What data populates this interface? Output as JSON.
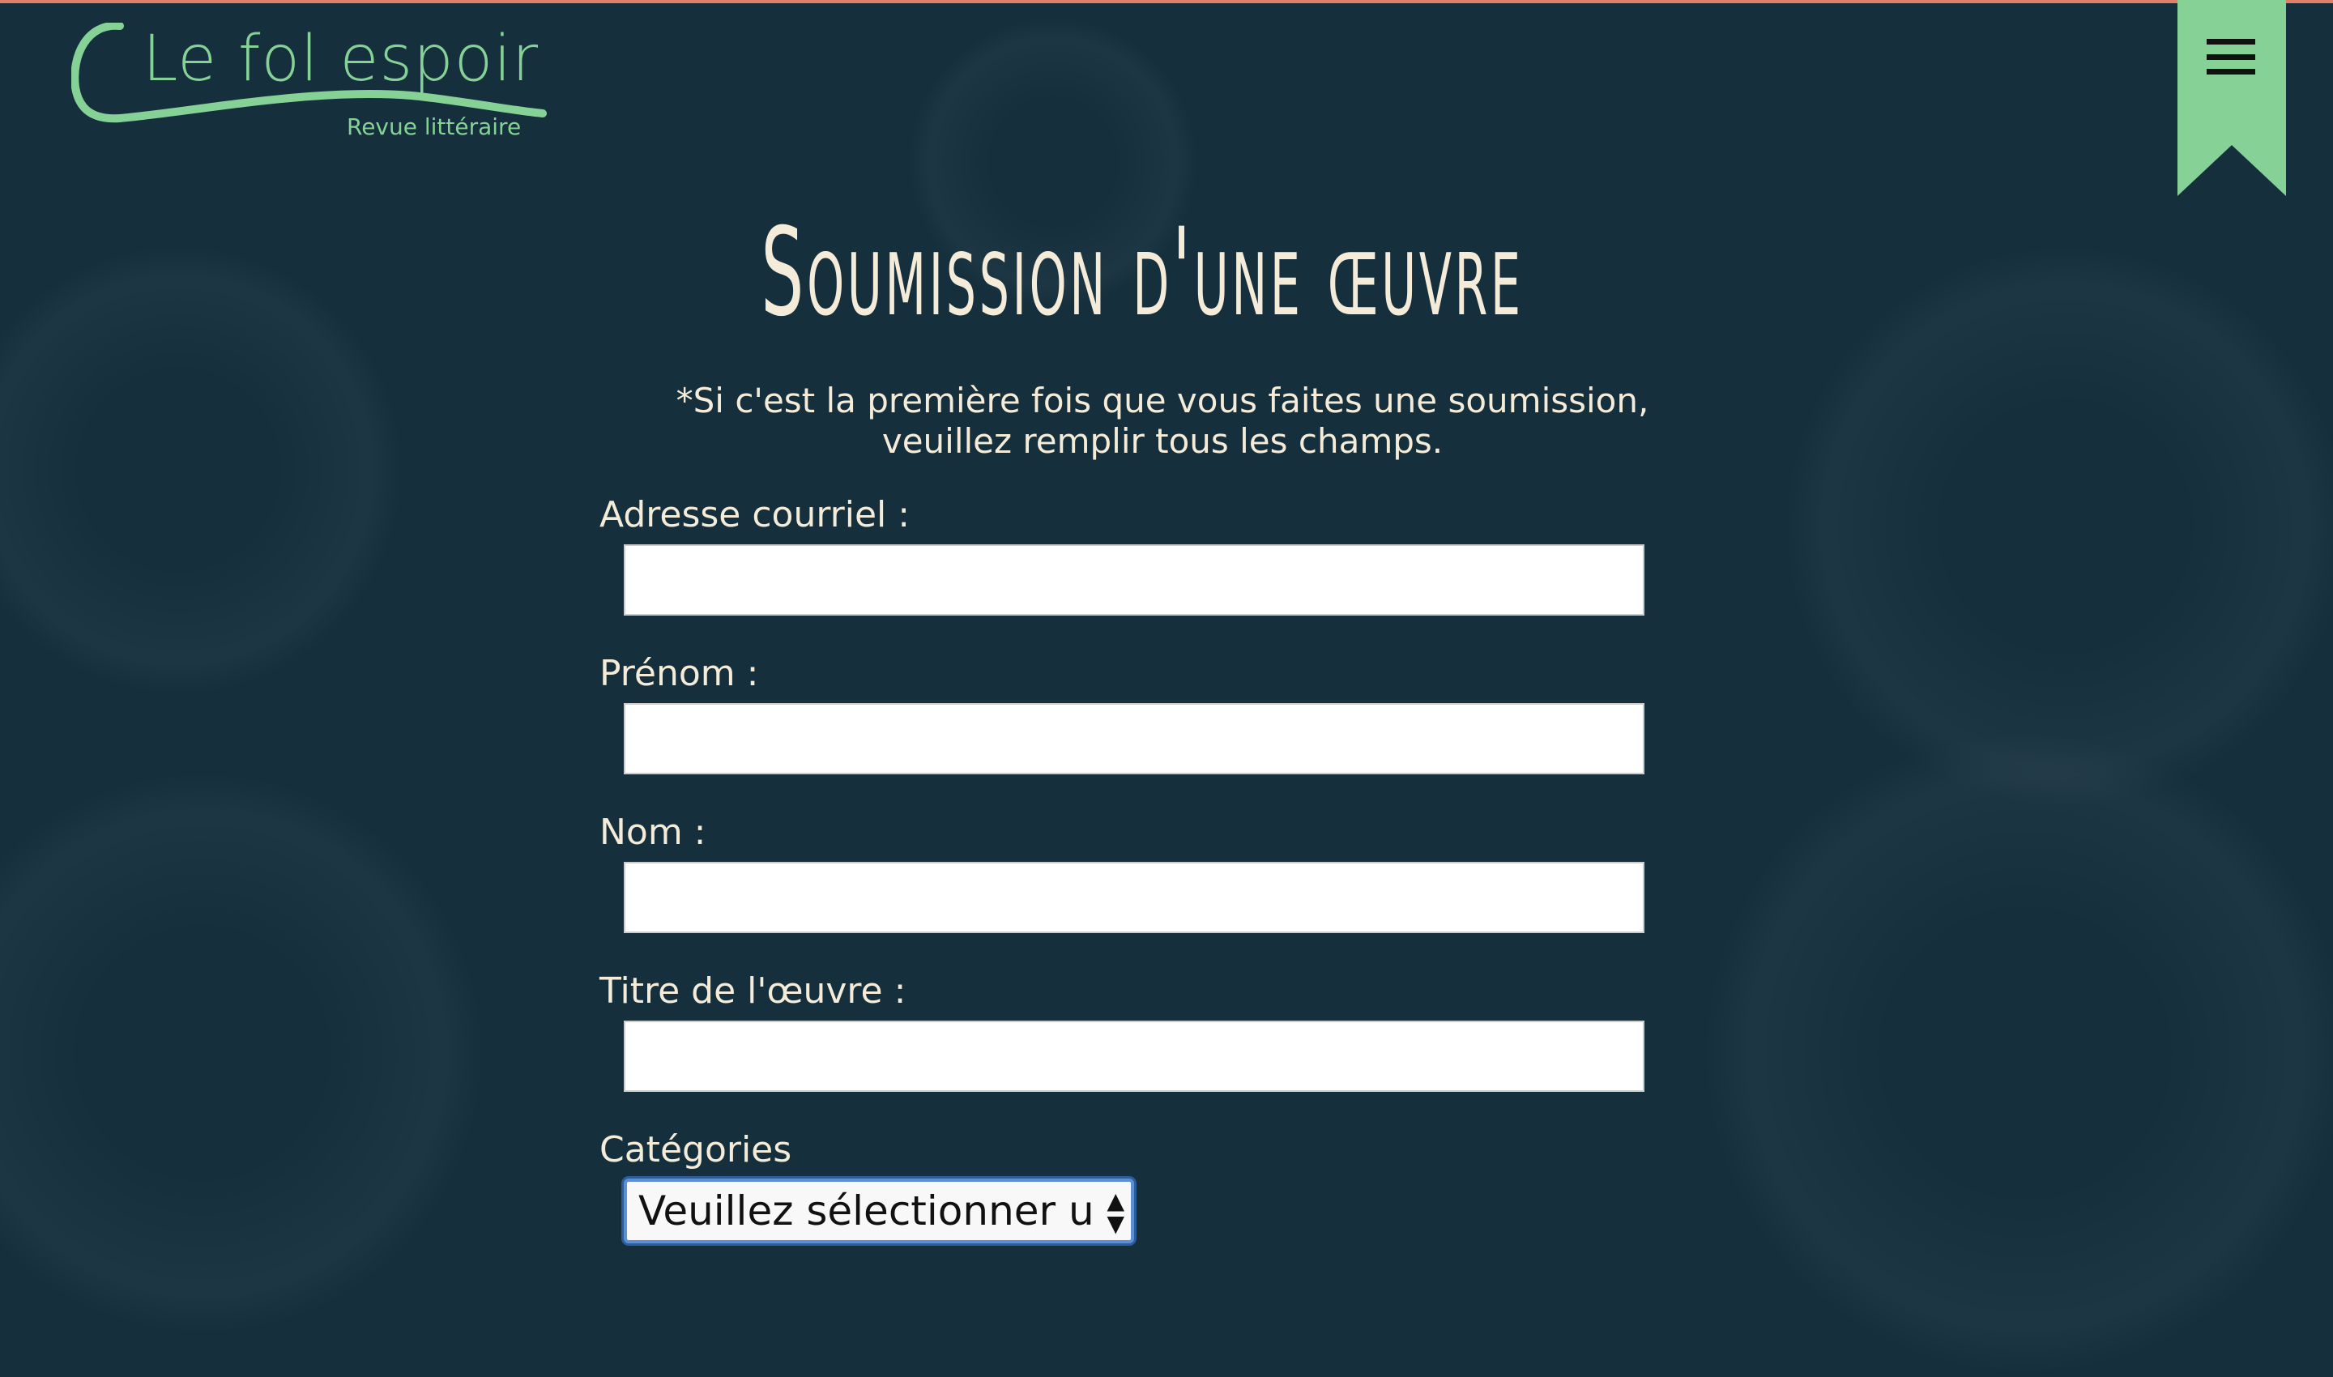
{
  "logo": {
    "title": "Le fol espoir",
    "subtitle": "Revue littéraire",
    "color": "#86d196"
  },
  "menu": {
    "icon": "hamburger-icon"
  },
  "page": {
    "title": "Soumission d'une œuvre",
    "note_line1": "*Si c'est la première fois que vous faites une soumission,",
    "note_line2": "veuillez remplir tous les champs."
  },
  "form": {
    "email_label": "Adresse courriel :",
    "email_value": "",
    "firstname_label": "Prénom :",
    "firstname_value": "",
    "lastname_label": "Nom :",
    "lastname_value": "",
    "title_label": "Titre de l'œuvre :",
    "title_value": "",
    "category_label": "Catégories",
    "category_selected": "Veuillez sélectionner une"
  },
  "colors": {
    "background": "#152f3d",
    "text": "#f4ecd9",
    "accent": "#86d196"
  }
}
